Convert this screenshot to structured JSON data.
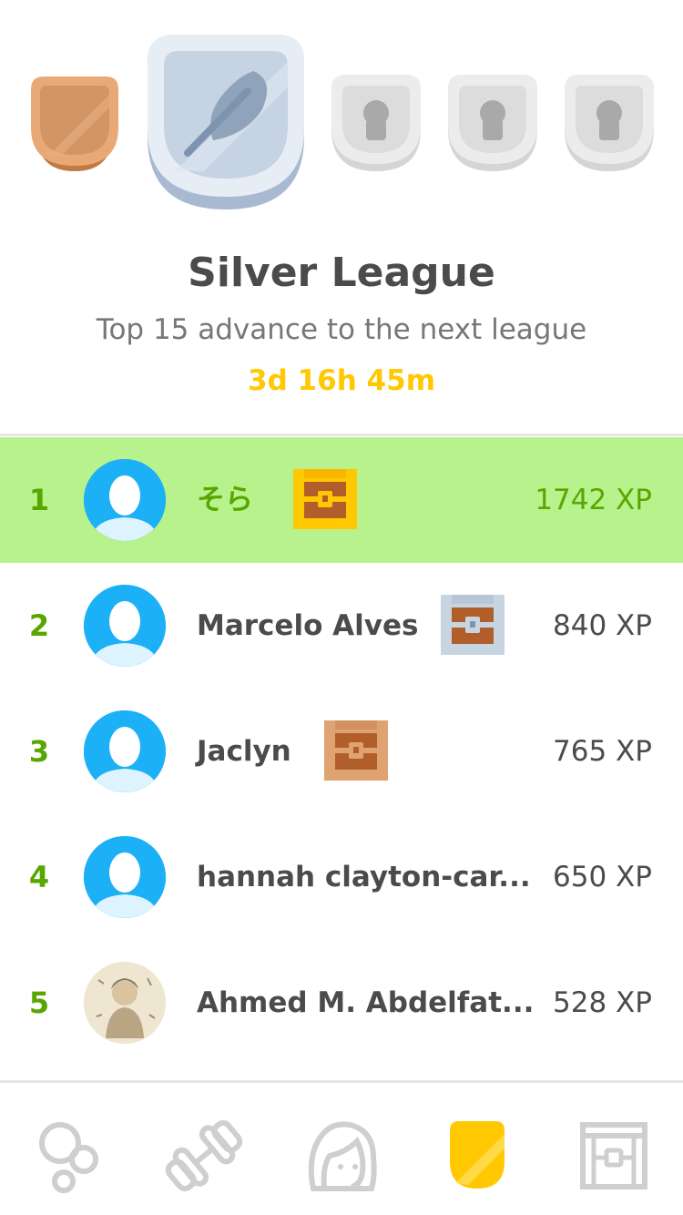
{
  "league": {
    "title": "Silver League",
    "subtitle": "Top 15 advance to the next league",
    "timer": "3d 16h 45m",
    "badges": [
      {
        "name": "bronze-league-badge",
        "state": "passed",
        "color": "#d89a62"
      },
      {
        "name": "silver-league-badge",
        "state": "current",
        "color": "#c6d3e2"
      },
      {
        "name": "locked-league-badge",
        "state": "locked",
        "color": "#e5e5e5"
      },
      {
        "name": "locked-league-badge",
        "state": "locked",
        "color": "#e5e5e5"
      },
      {
        "name": "locked-league-badge",
        "state": "locked",
        "color": "#e5e5e5"
      }
    ]
  },
  "leaderboard": [
    {
      "rank": "1",
      "name": "そら",
      "xp": "1742 XP",
      "chest": "gold-chest-icon",
      "avatar": "default-avatar",
      "current": true
    },
    {
      "rank": "2",
      "name": "Marcelo Alves",
      "xp": "840 XP",
      "chest": "silver-chest-icon",
      "avatar": "default-avatar",
      "current": false
    },
    {
      "rank": "3",
      "name": "Jaclyn",
      "xp": "765 XP",
      "chest": "bronze-chest-icon",
      "avatar": "default-avatar",
      "current": false
    },
    {
      "rank": "4",
      "name": "hannah clayton-car...",
      "xp": "650 XP",
      "chest": null,
      "avatar": "default-avatar",
      "current": false
    },
    {
      "rank": "5",
      "name": "Ahmed M. Abdelfat...",
      "xp": "528 XP",
      "chest": null,
      "avatar": "photo-avatar",
      "current": false
    }
  ],
  "nav": {
    "items": [
      "learn-tab",
      "practice-tab",
      "profile-tab",
      "leaderboard-tab",
      "shop-tab"
    ],
    "active": "leaderboard-tab"
  },
  "colors": {
    "accent_green": "#58a700",
    "highlight_row": "#b7f28d",
    "timer_gold": "#ffc800",
    "avatar_blue": "#1cb0f6"
  }
}
